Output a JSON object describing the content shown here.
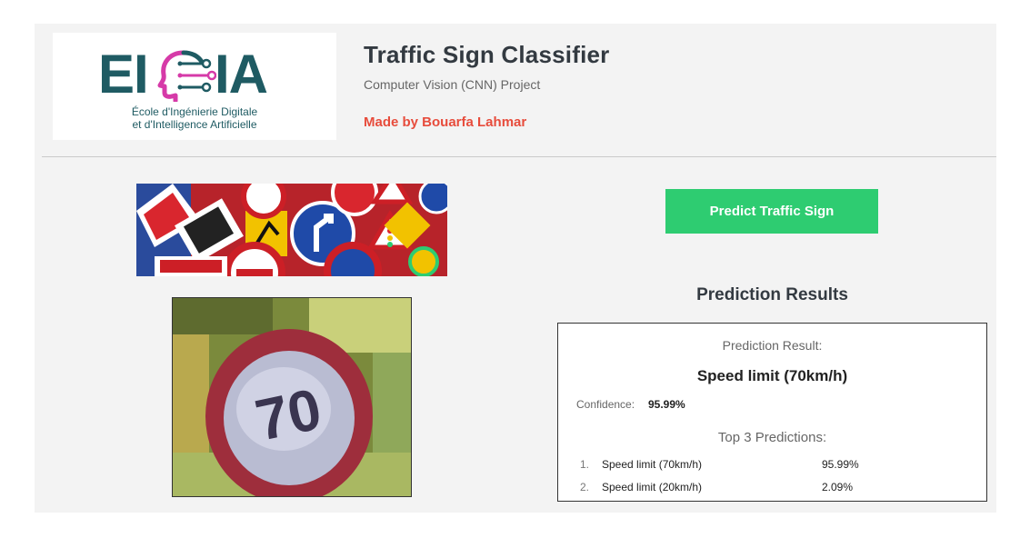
{
  "header": {
    "logo": {
      "letters_left": "EI",
      "letters_right": "IA",
      "subtitle_line1": "École d'Ingénierie Digitale",
      "subtitle_line2": "et d'Intelligence Artificielle"
    },
    "title": "Traffic Sign Classifier",
    "subtitle": "Computer Vision (CNN) Project",
    "author": "Made by Bouarfa Lahmar"
  },
  "actions": {
    "predict_label": "Predict Traffic Sign"
  },
  "results": {
    "heading": "Prediction Results",
    "caption": "Prediction Result:",
    "predicted_class": "Speed limit (70km/h)",
    "confidence_label": "Confidence:",
    "confidence_value": "95.99%",
    "top_title": "Top 3 Predictions:",
    "top": [
      {
        "rank": "1.",
        "label": "Speed limit (70km/h)",
        "percent": "95.99%"
      },
      {
        "rank": "2.",
        "label": "Speed limit (20km/h)",
        "percent": "2.09%"
      }
    ]
  },
  "colors": {
    "accent_green": "#2ecc71",
    "author_red": "#e74c3c",
    "logo_teal": "#1f5b63",
    "logo_pink": "#d63aa8"
  },
  "icons": {
    "logo_head": "head-circuit-icon"
  }
}
